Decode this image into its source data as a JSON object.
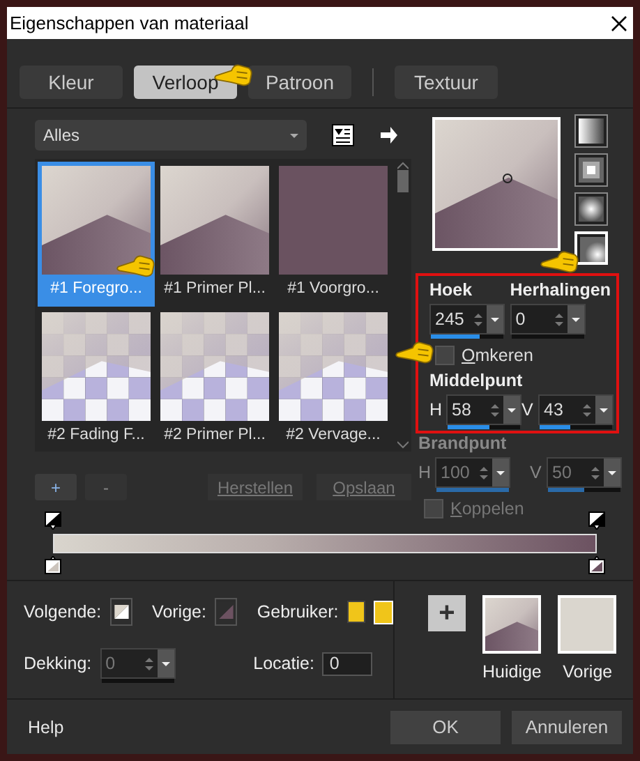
{
  "window": {
    "title": "Eigenschappen van materiaal"
  },
  "tabs": [
    {
      "label": "Kleur",
      "selected": false
    },
    {
      "label": "Verloop",
      "selected": true
    },
    {
      "label": "Patroon",
      "selected": false
    },
    {
      "label": "Textuur",
      "selected": false
    }
  ],
  "library": {
    "filter": "Alles",
    "thumbnails": [
      {
        "label": "#1 Foregro...",
        "kind": "diagonal",
        "selected": true
      },
      {
        "label": "#1 Primer Pl...",
        "kind": "diagonal",
        "selected": false
      },
      {
        "label": "#1 Voorgro...",
        "kind": "solid",
        "selected": false
      },
      {
        "label": "#2 Fading F...",
        "kind": "fade",
        "selected": false
      },
      {
        "label": "#2 Primer Pl...",
        "kind": "fade",
        "selected": false
      },
      {
        "label": "#2 Vervage...",
        "kind": "fade",
        "selected": false
      }
    ]
  },
  "gradient_types": [
    {
      "kind": "linear",
      "selected": false
    },
    {
      "kind": "rectangular",
      "selected": false
    },
    {
      "kind": "radial",
      "selected": false
    },
    {
      "kind": "sunburst",
      "selected": true
    }
  ],
  "angle": {
    "label": "Hoek",
    "value": "245",
    "level": 0.68
  },
  "repeats": {
    "label": "Herhalingen",
    "value": "0",
    "level": 0
  },
  "invert": {
    "label": "Omkeren",
    "checked": false
  },
  "center": {
    "label": "Middelpunt",
    "h": {
      "prefix": "H",
      "value": "58",
      "level": 0.58
    },
    "v": {
      "prefix": "V",
      "value": "43",
      "level": 0.43
    }
  },
  "focal": {
    "label": "Brandpunt",
    "disabled": true,
    "h": {
      "prefix": "H",
      "value": "100",
      "level": 1
    },
    "v": {
      "prefix": "V",
      "value": "50",
      "level": 0.5
    },
    "link": {
      "label": "Koppelen",
      "checked": false
    }
  },
  "stop_buttons": [
    "+",
    "-"
  ],
  "actions": [
    {
      "label": "Herstellen",
      "disabled": true
    },
    {
      "label": "Opslaan",
      "disabled": true
    }
  ],
  "stop_colors": {
    "next": "Volgende:",
    "previous": "Vorige:",
    "custom": "Gebruiker:"
  },
  "opacity": {
    "label": "Dekking:",
    "value": "0",
    "level": 0,
    "disabled": true
  },
  "location": {
    "label": "Locatie:",
    "value": "0"
  },
  "add_button": "+",
  "swatches": [
    {
      "label": "Huidige",
      "kind": "gradient"
    },
    {
      "label": "Vorige",
      "kind": "solid"
    }
  ],
  "footer": {
    "help": "Help",
    "buttons": [
      "OK",
      "Annuleren"
    ]
  }
}
